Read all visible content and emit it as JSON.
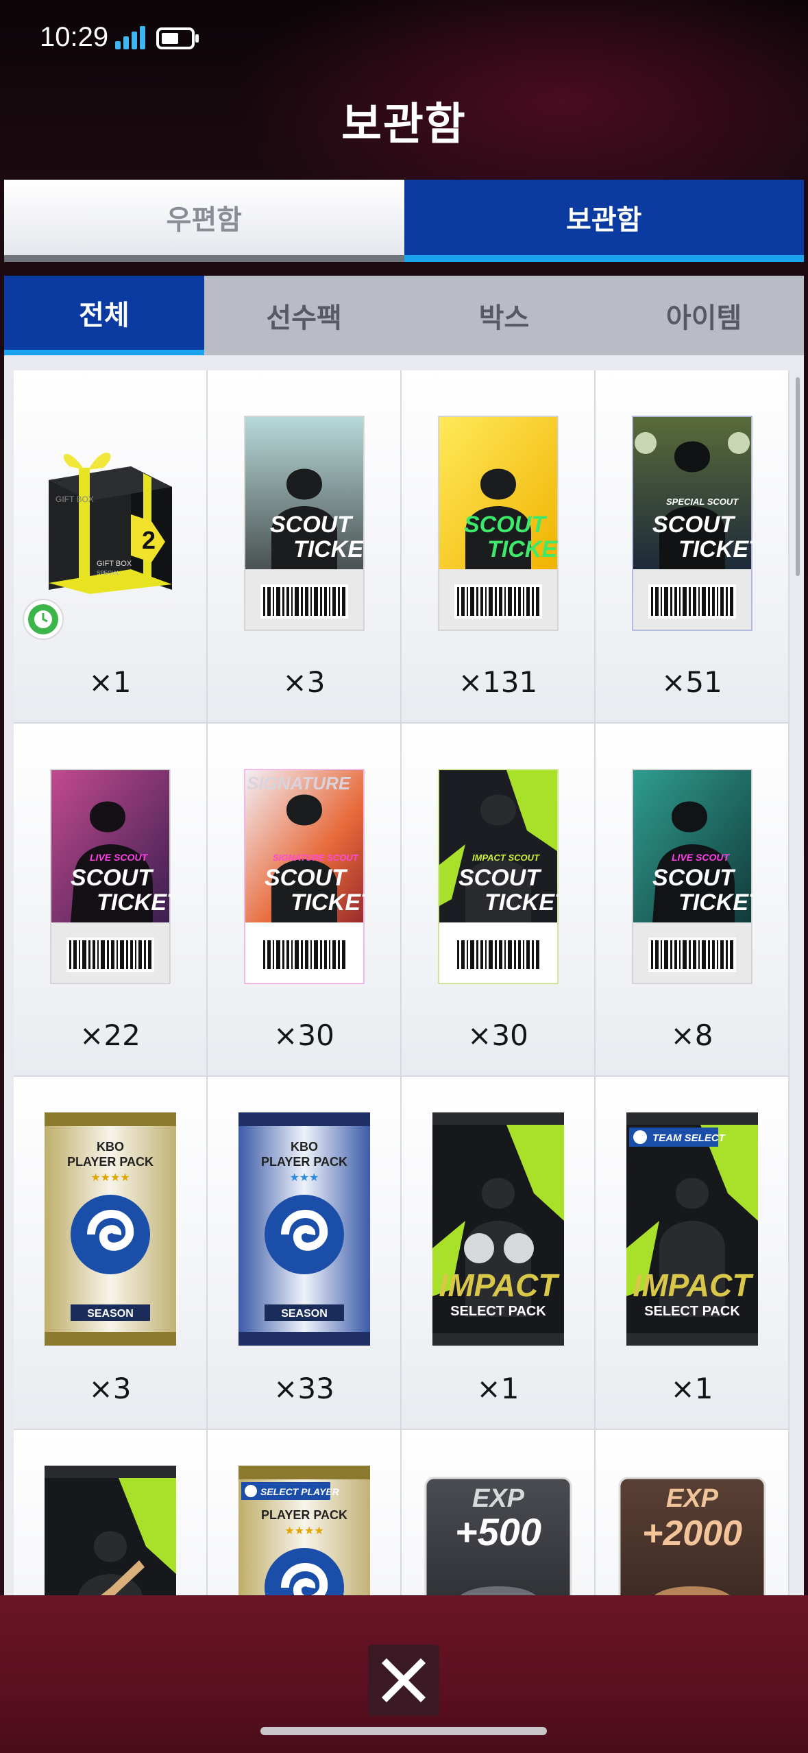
{
  "status_bar": {
    "time": "10:29"
  },
  "header": {
    "title": "보관함"
  },
  "main_tabs": [
    {
      "label": "우편함",
      "active": false
    },
    {
      "label": "보관함",
      "active": true
    }
  ],
  "sub_tabs": [
    {
      "label": "전체",
      "active": true
    },
    {
      "label": "선수팩",
      "active": false
    },
    {
      "label": "박스",
      "active": false
    },
    {
      "label": "아이템",
      "active": false
    }
  ],
  "items": [
    {
      "type": "gift-box",
      "qty": "×1",
      "box_label": "GIFT BOX",
      "box_sub": "SPECIAL",
      "tag": "2"
    },
    {
      "type": "scout-ticket",
      "qty": "×3",
      "line1": "SCOUT",
      "line2": "TICKET",
      "sub": ""
    },
    {
      "type": "scout-ticket",
      "qty": "×131",
      "line1": "SCOUT",
      "line2": "TICKET",
      "sub": ""
    },
    {
      "type": "scout-ticket",
      "qty": "×51",
      "line1": "SCOUT",
      "line2": "TICKET",
      "sub": "SPECIAL SCOUT"
    },
    {
      "type": "scout-ticket",
      "qty": "×22",
      "line1": "SCOUT",
      "line2": "TICKET",
      "sub": "LIVE SCOUT"
    },
    {
      "type": "scout-ticket",
      "qty": "×30",
      "line1": "SCOUT",
      "line2": "TICKET",
      "sub": "SIGNATURE SCOUT",
      "bg_text": "SIGNATURE"
    },
    {
      "type": "scout-ticket",
      "qty": "×30",
      "line1": "SCOUT",
      "line2": "TICKET",
      "sub": "IMPACT SCOUT"
    },
    {
      "type": "scout-ticket",
      "qty": "×8",
      "line1": "SCOUT",
      "line2": "TICKET",
      "sub": "LIVE SCOUT"
    },
    {
      "type": "player-pack",
      "qty": "×3",
      "l1": "KBO",
      "l2": "PLAYER PACK",
      "stars": "★★★★",
      "bottom": "SEASON"
    },
    {
      "type": "player-pack",
      "qty": "×33",
      "l1": "KBO",
      "l2": "PLAYER PACK",
      "stars": "★★★",
      "bottom": "SEASON"
    },
    {
      "type": "impact-pack",
      "qty": "×1",
      "l1": "IMPACT",
      "l2": "SELECT PACK"
    },
    {
      "type": "impact-pack",
      "qty": "×1",
      "l1": "IMPACT",
      "l2": "SELECT PACK",
      "badge": "TEAM SELECT"
    },
    {
      "type": "impact-partial",
      "qty": ""
    },
    {
      "type": "player-pack-partial",
      "qty": "",
      "badge": "SELECT PLAYER",
      "l2": "PLAYER PACK",
      "stars": "★★★★"
    },
    {
      "type": "exp-card",
      "qty": "",
      "l1": "EXP",
      "l2": "+500"
    },
    {
      "type": "exp-card",
      "qty": "",
      "l1": "EXP",
      "l2": "+2000"
    }
  ],
  "colors": {
    "accent_blue": "#0b3aa0",
    "underline_blue": "#1aa3ef",
    "bottom_bar": "#5a1020"
  }
}
